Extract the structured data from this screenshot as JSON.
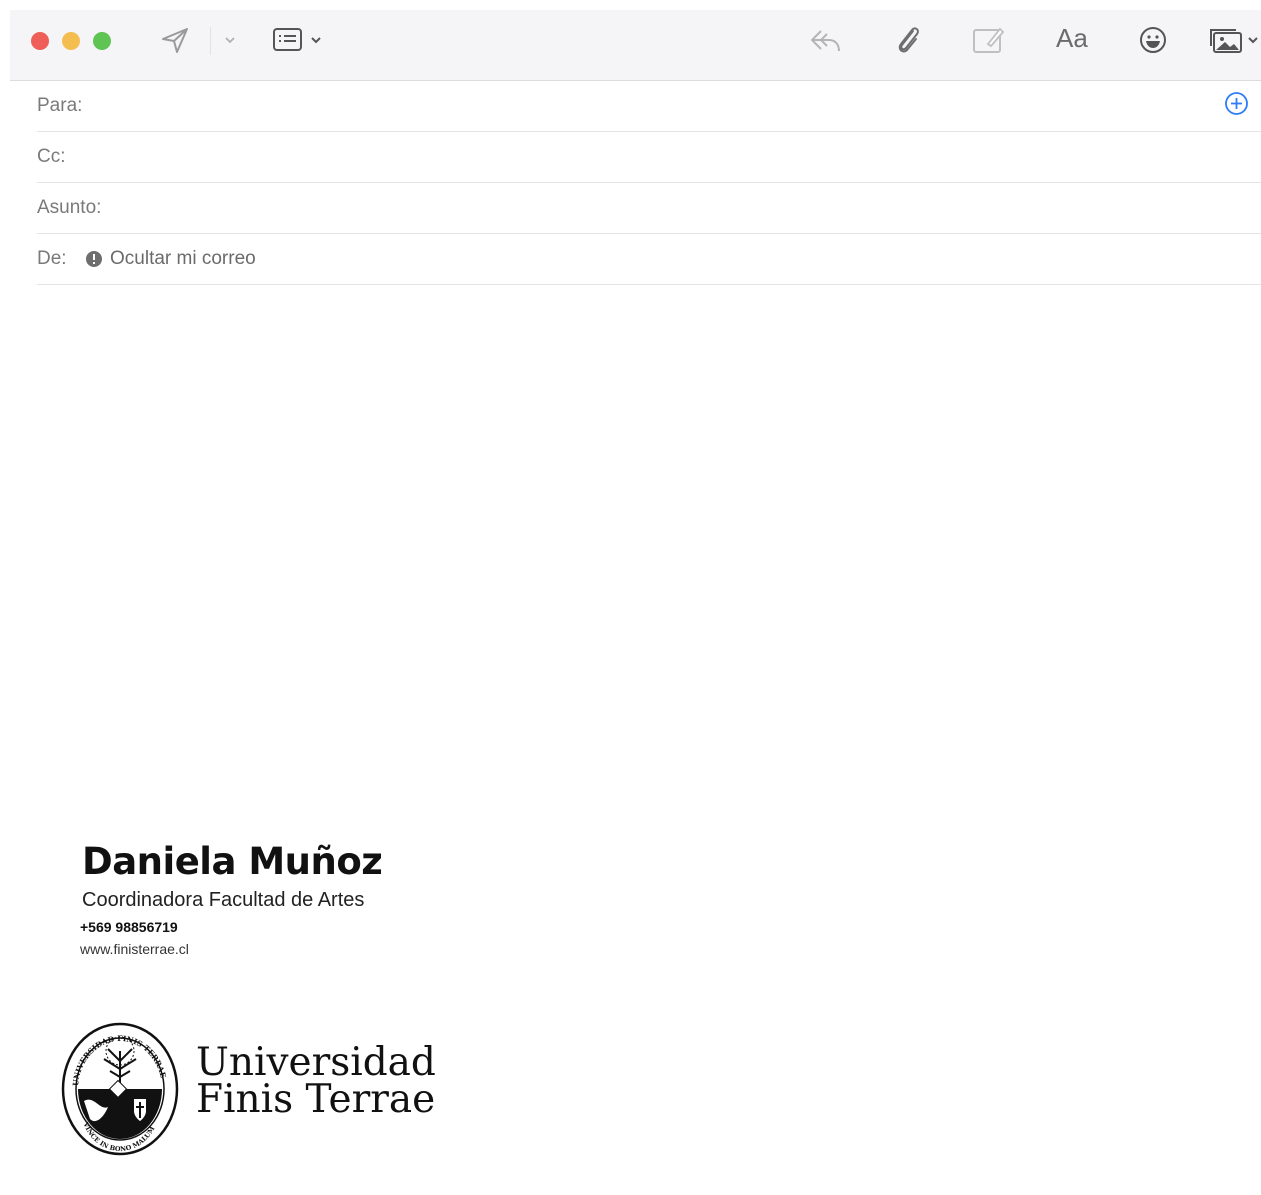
{
  "toolbar": {
    "icons": [
      "send-icon",
      "chevron-down-icon",
      "header-fields-icon",
      "reply-icon",
      "paperclip-icon",
      "markup-icon",
      "format-text-button",
      "emoji-icon",
      "photo-browser-icon"
    ],
    "format_label": "Aa"
  },
  "fields": {
    "to_label": "Para:",
    "cc_label": "Cc:",
    "subject_label": "Asunto:",
    "from_label": "De:",
    "from_value": "Ocultar mi correo"
  },
  "colors": {
    "accent": "#2f7cf6",
    "close": "#ed5f58",
    "minimize": "#f4bd4f",
    "zoom": "#5fc454"
  },
  "signature": {
    "name": "Daniela Muñoz",
    "role": "Coordinadora Facultad de Artes",
    "phone": "+569 98856719",
    "website": "www.finisterrae.cl",
    "logo_line1": "Universidad",
    "logo_line2": "Finis Terrae",
    "seal_text_top": "UNIVERSIDAD FINIS TERRAE",
    "seal_text_bottom": "VINCE IN BONO MALUM"
  }
}
